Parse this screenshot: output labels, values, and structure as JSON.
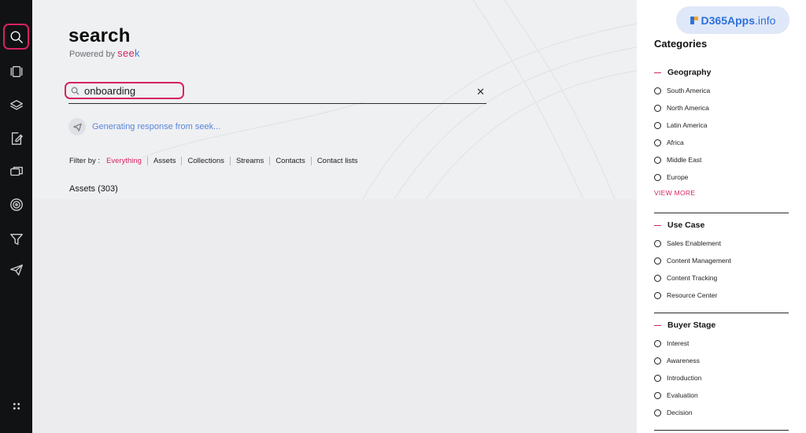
{
  "rail": {
    "items": [
      {
        "icon": "search-icon",
        "active": true
      },
      {
        "icon": "carousel-icon",
        "active": false
      },
      {
        "icon": "layers-icon",
        "active": false
      },
      {
        "icon": "edit-document-icon",
        "active": false
      },
      {
        "icon": "chat-icon",
        "active": false
      },
      {
        "icon": "target-icon",
        "active": false
      },
      {
        "icon": "filter-icon",
        "active": false
      },
      {
        "icon": "send-icon",
        "active": false
      }
    ],
    "bottom_icon": "apps-grid-icon"
  },
  "main": {
    "title": "search",
    "powered_prefix": "Powered by",
    "powered_brand_main": "see",
    "powered_brand_end": "k",
    "search": {
      "value": "onboarding",
      "clear_glyph": "✕"
    },
    "generating_text": "Generating response from seek...",
    "filter": {
      "label": "Filter by :",
      "options": [
        "Everything",
        "Assets",
        "Collections",
        "Streams",
        "Contacts",
        "Contact lists"
      ],
      "selected": "Everything"
    },
    "assets_count_label": "Assets (303)"
  },
  "panel": {
    "badge": {
      "brand": "D365Apps",
      "suffix": ".info"
    },
    "title": "Categories",
    "sections": [
      {
        "name": "Geography",
        "options": [
          "South America",
          "North America",
          "Latin America",
          "Africa",
          "Middle East",
          "Europe"
        ],
        "view_more": "VIEW MORE"
      },
      {
        "name": "Use Case",
        "options": [
          "Sales Enablement",
          "Content Management",
          "Content Tracking",
          "Resource Center"
        ]
      },
      {
        "name": "Buyer Stage",
        "options": [
          "Interest",
          "Awareness",
          "Introduction",
          "Evaluation",
          "Decision"
        ]
      }
    ]
  },
  "colors": {
    "accent": "#d6245e",
    "link_blue": "#5b86d8",
    "rail_bg": "#111214"
  }
}
